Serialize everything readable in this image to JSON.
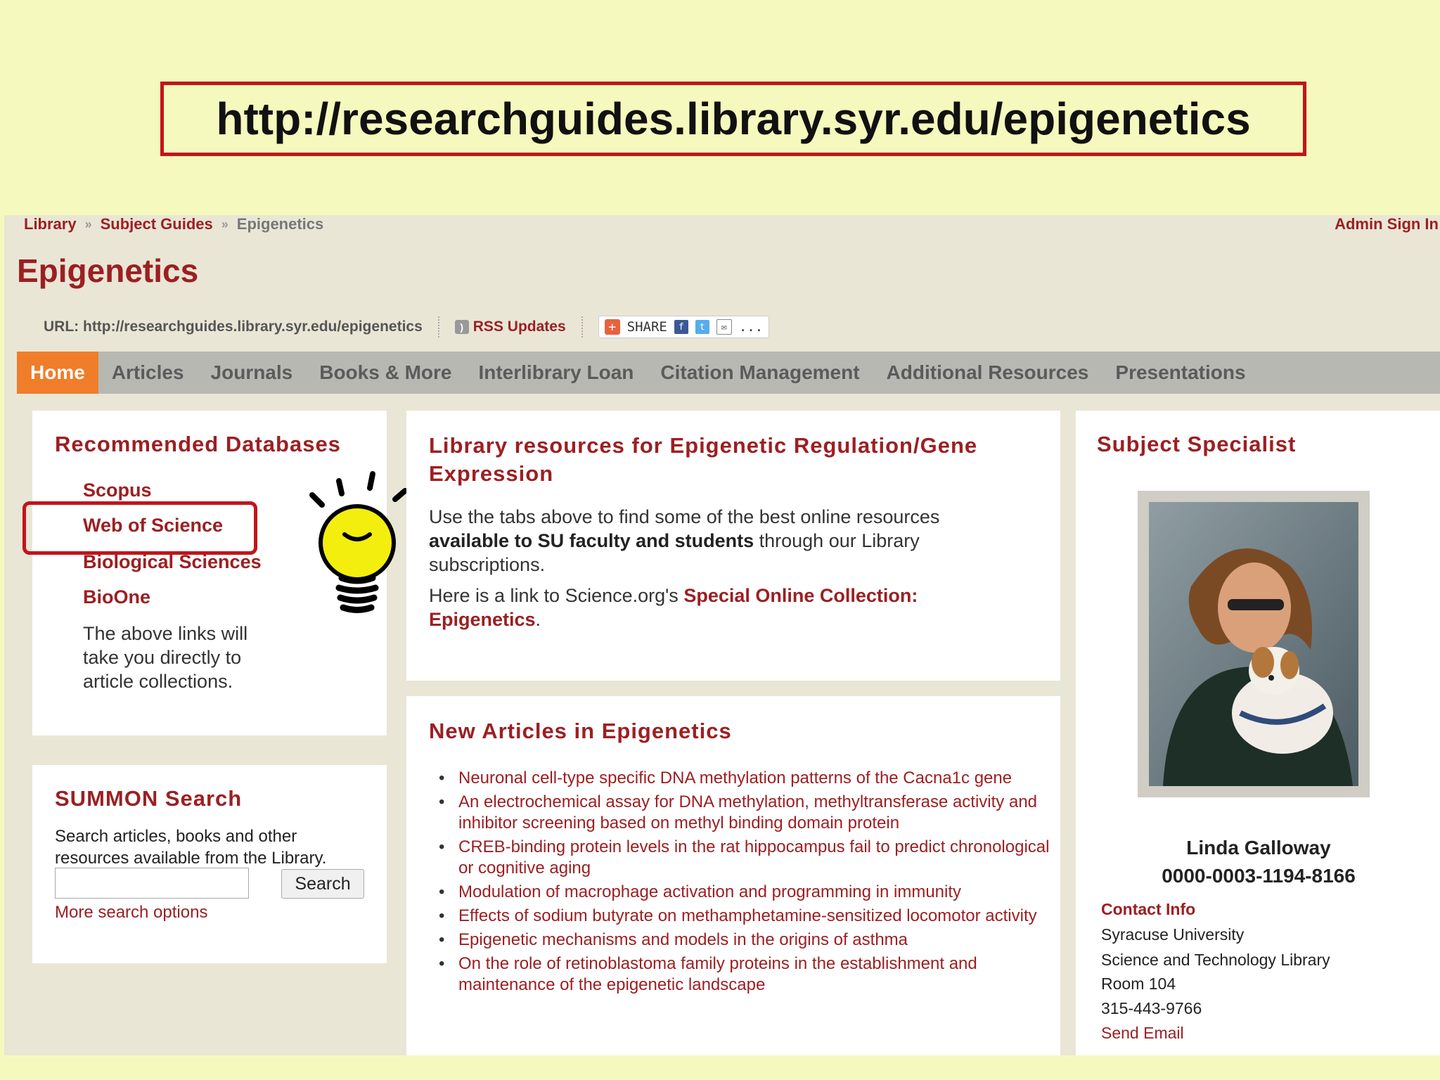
{
  "banner_url": "http://researchguides.library.syr.edu/epigenetics",
  "breadcrumb": {
    "library": "Library",
    "sep": "»",
    "subject_guides": "Subject Guides",
    "current": "Epigenetics"
  },
  "admin_sign_in": "Admin Sign In",
  "guide_title": "Epigenetics",
  "url_line": "URL: http://researchguides.library.syr.edu/epigenetics",
  "rss_label": "RSS Updates",
  "share_label": "SHARE",
  "share_more": "...",
  "nav": [
    "Home",
    "Articles",
    "Journals",
    "Books & More",
    "Interlibrary Loan",
    "Citation Management",
    "Additional Resources",
    "Presentations"
  ],
  "recommended": {
    "title": "Recommended Databases",
    "links": [
      "Scopus",
      "Web of Science",
      "Biological Sciences",
      "BioOne"
    ],
    "note": "The above links will take you directly to article collections."
  },
  "summon": {
    "title": "SUMMON Search",
    "description": "Search articles, books and other resources available from the Library.",
    "button": "Search",
    "more": "More search options"
  },
  "library_resources": {
    "title": "Library resources for Epigenetic Regulation/Gene Expression",
    "p1_a": "Use the tabs above to find some of the best online resources ",
    "p1_bold": "available to SU faculty and students",
    "p1_b": " through our Library subscriptions.",
    "p2_a": "Here is a link to Science.org's ",
    "p2_link": "Special Online Collection: Epigenetics",
    "p2_b": "."
  },
  "new_articles": {
    "title": "New Articles in Epigenetics",
    "items": [
      "Neuronal cell-type specific DNA methylation patterns of the Cacna1c gene",
      "An electrochemical assay for DNA methylation, methyltransferase activity and inhibitor screening based on methyl binding domain protein",
      "CREB-binding protein levels in the rat hippocampus fail to predict chronological or cognitive aging",
      "Modulation of macrophage activation and programming in immunity",
      "Effects of sodium butyrate on methamphetamine-sensitized locomotor activity",
      "Epigenetic mechanisms and models in the origins of asthma",
      "On the role of retinoblastoma family proteins in the establishment and maintenance of the epigenetic landscape"
    ]
  },
  "specialist": {
    "title": "Subject Specialist",
    "name": "Linda Galloway",
    "orcid": "0000-0003-1194-8166",
    "contact_label": "Contact Info",
    "lines": [
      "Syracuse University",
      "Science and Technology Library",
      "Room 104",
      "315-443-9766"
    ],
    "send_email": "Send Email"
  },
  "colors": {
    "background": "#f6f9bd",
    "accent_red": "#9c1f22",
    "highlight_red": "#c2141b",
    "nav_active": "#f07d2a",
    "nav_bg": "#b8b8b3"
  }
}
